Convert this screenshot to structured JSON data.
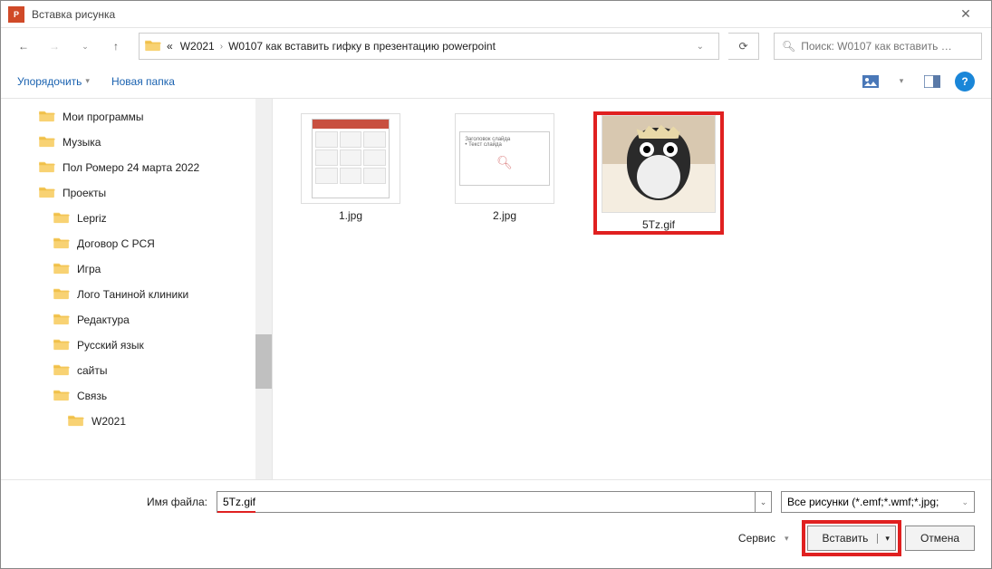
{
  "title": "Вставка рисунка",
  "path": {
    "prefix": "«",
    "segments": [
      "W2021",
      "W0107 как вставить гифку в презентацию powerpoint"
    ]
  },
  "search": {
    "placeholder": "Поиск: W0107 как вставить …"
  },
  "toolbar": {
    "organize": "Упорядочить",
    "new_folder": "Новая папка"
  },
  "tree": [
    {
      "label": "Мои программы",
      "indent": 42
    },
    {
      "label": "Музыка",
      "indent": 42
    },
    {
      "label": "Пол Ромеро 24 марта 2022",
      "indent": 42
    },
    {
      "label": "Проекты",
      "indent": 42
    },
    {
      "label": "Lepriz",
      "indent": 58
    },
    {
      "label": "Договор С РСЯ",
      "indent": 58
    },
    {
      "label": "Игра",
      "indent": 58
    },
    {
      "label": "Лого Таниной клиники",
      "indent": 58
    },
    {
      "label": "Редактура",
      "indent": 58
    },
    {
      "label": "Русский язык",
      "indent": 58
    },
    {
      "label": "сайты",
      "indent": 58
    },
    {
      "label": "Связь",
      "indent": 58
    },
    {
      "label": "W2021",
      "indent": 74
    }
  ],
  "files": [
    {
      "name": "1.jpg",
      "selected": false,
      "kind": "paper"
    },
    {
      "name": "2.jpg",
      "selected": false,
      "kind": "slide"
    },
    {
      "name": "5Tz.gif",
      "selected": true,
      "kind": "penguin"
    }
  ],
  "bottom": {
    "filename_label": "Имя файла:",
    "filename_value": "5Tz.gif",
    "filter": "Все рисунки (*.emf;*.wmf;*.jpg;",
    "service": "Сервис",
    "insert": "Вставить",
    "cancel": "Отмена"
  }
}
